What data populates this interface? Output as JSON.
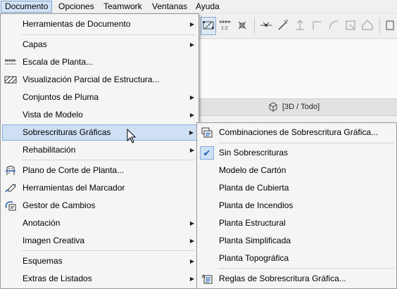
{
  "menubar": {
    "items": [
      {
        "label": "Documento"
      },
      {
        "label": "Opciones"
      },
      {
        "label": "Teamwork"
      },
      {
        "label": "Ventanas"
      },
      {
        "label": "Ayuda"
      }
    ]
  },
  "view_bar": {
    "label": "[3D / Todo]"
  },
  "main_menu": {
    "items": [
      {
        "label": "Herramientas de Documento"
      },
      {
        "label": "Capas"
      },
      {
        "label": "Escala de Planta..."
      },
      {
        "label": "Visualización Parcial de Estructura..."
      },
      {
        "label": "Conjuntos de Pluma"
      },
      {
        "label": "Vista de Modelo"
      },
      {
        "label": "Sobrescrituras Gráficas"
      },
      {
        "label": "Rehabilitación"
      },
      {
        "label": "Plano de Corte de Planta..."
      },
      {
        "label": "Herramientas del Marcador"
      },
      {
        "label": "Gestor de Cambios"
      },
      {
        "label": "Anotación"
      },
      {
        "label": "Imagen Creativa"
      },
      {
        "label": "Esquemas"
      },
      {
        "label": "Extras de Listados"
      }
    ]
  },
  "sub_menu": {
    "items": [
      {
        "label": "Combinaciones de Sobrescritura Gráfica..."
      },
      {
        "label": "Sin Sobrescrituras"
      },
      {
        "label": "Modelo de Cartón"
      },
      {
        "label": "Planta de Cubierta"
      },
      {
        "label": "Planta de Incendios"
      },
      {
        "label": "Planta Estructural"
      },
      {
        "label": "Planta Simplificada"
      },
      {
        "label": "Planta Topográfica"
      },
      {
        "label": "Reglas de Sobrescritura Gráfica..."
      }
    ],
    "checked_item": "Sin Sobrescrituras"
  },
  "colors": {
    "highlight_bg": "#cfe0f5",
    "highlight_border": "#84acdd",
    "menu_bg": "#f5f5f5"
  }
}
